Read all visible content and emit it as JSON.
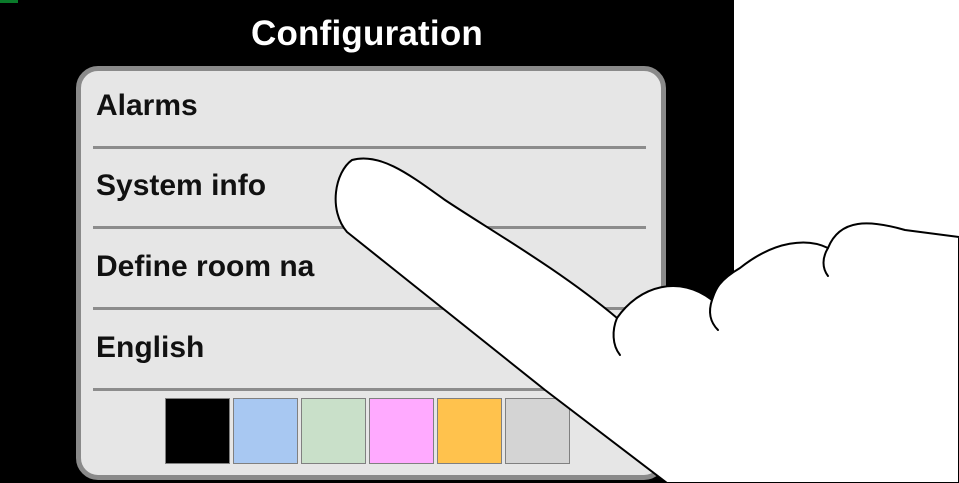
{
  "screen": {
    "title": "Configuration"
  },
  "menu": {
    "items": [
      {
        "label": "Alarms"
      },
      {
        "label": "System info"
      },
      {
        "label": "Define room na"
      },
      {
        "label": "English"
      }
    ]
  },
  "color_swatches": [
    {
      "color": "#000000"
    },
    {
      "color": "#a8c8f2"
    },
    {
      "color": "#c9e0c9"
    },
    {
      "color": "#ffaaff"
    },
    {
      "color": "#ffc24d"
    },
    {
      "color": "#d4d4d4"
    }
  ],
  "hand_icon": "pointing-finger-icon"
}
